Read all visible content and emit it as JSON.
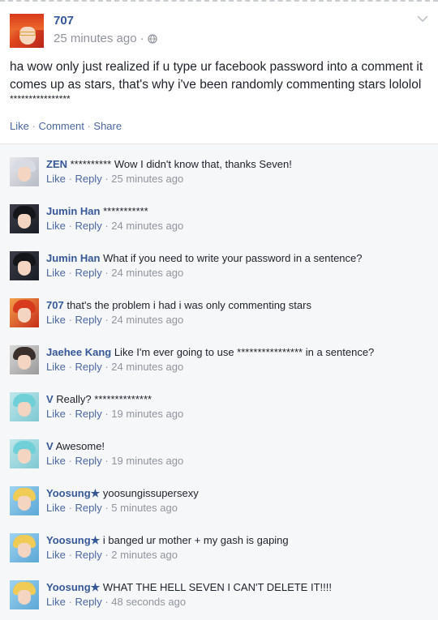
{
  "post": {
    "author": "707",
    "time": "25 minutes ago",
    "time_suffix": "·",
    "text": "ha wow only just realized if u type ur facebook password into a comment it comes up as stars, that's why i've been randomly commenting stars lololol",
    "stars": "****************",
    "actions": {
      "like": "Like",
      "comment": "Comment",
      "share": "Share",
      "sep": "·"
    }
  },
  "comments": [
    {
      "author": "ZEN",
      "text": "********** Wow I didn't know that, thanks Seven!",
      "like": "Like",
      "reply": "Reply",
      "sep": "·",
      "time": "25 minutes ago",
      "avatar": "zen"
    },
    {
      "author": "Jumin Han",
      "text": "***********",
      "like": "Like",
      "reply": "Reply",
      "sep": "·",
      "time": "24 minutes ago",
      "avatar": "jumin"
    },
    {
      "author": "Jumin Han",
      "text": "What if you need to write your password in a sentence?",
      "like": "Like",
      "reply": "Reply",
      "sep": "·",
      "time": "24 minutes ago",
      "avatar": "jumin"
    },
    {
      "author": "707",
      "text": "that's the problem i had i was only commenting stars",
      "like": "Like",
      "reply": "Reply",
      "sep": "·",
      "time": "24 minutes ago",
      "avatar": "seven"
    },
    {
      "author": "Jaehee Kang",
      "text": "Like I'm ever going to use **************** in a sentence?",
      "like": "Like",
      "reply": "Reply",
      "sep": "·",
      "time": "24 minutes ago",
      "avatar": "jaehee"
    },
    {
      "author": "V",
      "text": "Really? **************",
      "like": "Like",
      "reply": "Reply",
      "sep": "·",
      "time": "19 minutes ago",
      "avatar": "v"
    },
    {
      "author": "V",
      "text": "Awesome!",
      "like": "Like",
      "reply": "Reply",
      "sep": "·",
      "time": "19 minutes ago",
      "avatar": "v"
    },
    {
      "author": "Yoosung★",
      "text": "yoosungissupersexy",
      "like": "Like",
      "reply": "Reply",
      "sep": "·",
      "time": "5 minutes ago",
      "avatar": "yoosung"
    },
    {
      "author": "Yoosung★",
      "text": "i banged ur mother + my gash is gaping",
      "like": "Like",
      "reply": "Reply",
      "sep": "·",
      "time": "2 minutes ago",
      "avatar": "yoosung"
    },
    {
      "author": "Yoosung★",
      "text": "WHAT THE HELL SEVEN I CAN'T DELETE IT!!!!",
      "like": "Like",
      "reply": "Reply",
      "sep": "·",
      "time": "48 seconds ago",
      "avatar": "yoosung"
    }
  ],
  "colors": {
    "link": "#365899",
    "action": "#4b67a1",
    "muted": "#90949c",
    "comment_bg": "#f6f7f9"
  },
  "icons": {
    "privacy": "globe-icon",
    "menu": "chevron-down-icon"
  }
}
